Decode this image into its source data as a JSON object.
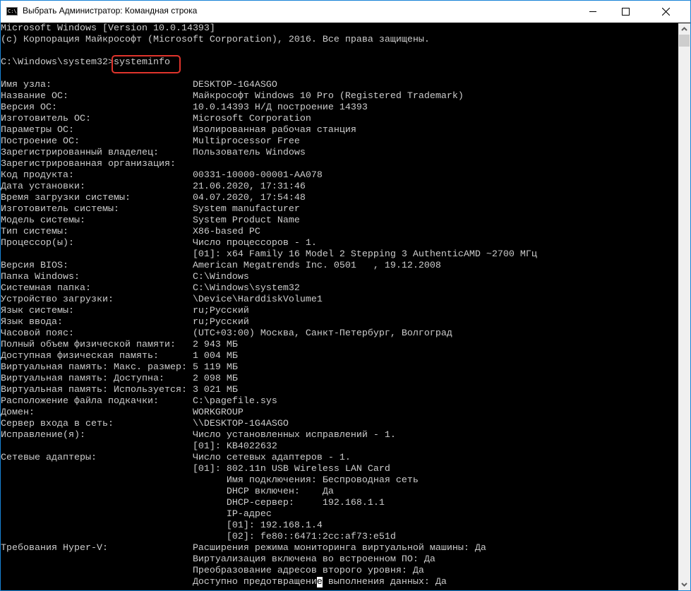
{
  "window": {
    "title": "Выбрать Администратор: Командная строка",
    "icon_text": "C:\\."
  },
  "console": {
    "header": [
      "Microsoft Windows [Version 10.0.14393]",
      "(c) Корпорация Майкрософт (Microsoft Corporation), 2016. Все права защищены."
    ],
    "prompt": "C:\\Windows\\system32>",
    "command": "systeminfo",
    "entries": [
      {
        "label": "Имя узла:",
        "value": "DESKTOP-1G4ASGO"
      },
      {
        "label": "Название ОС:",
        "value": "Майкрософт Windows 10 Pro (Registered Trademark)"
      },
      {
        "label": "Версия ОС:",
        "value": "10.0.14393 Н/Д построение 14393"
      },
      {
        "label": "Изготовитель ОС:",
        "value": "Microsoft Corporation"
      },
      {
        "label": "Параметры ОС:",
        "value": "Изолированная рабочая станция"
      },
      {
        "label": "Построение ОС:",
        "value": "Multiprocessor Free"
      },
      {
        "label": "Зарегистрированный владелец:",
        "value": "Пользователь Windows"
      },
      {
        "label": "Зарегистрированная организация:",
        "value": ""
      },
      {
        "label": "Код продукта:",
        "value": "00331-10000-00001-AA078"
      },
      {
        "label": "Дата установки:",
        "value": "21.06.2020, 17:31:46"
      },
      {
        "label": "Время загрузки системы:",
        "value": "04.07.2020, 17:54:48"
      },
      {
        "label": "Изготовитель системы:",
        "value": "System manufacturer"
      },
      {
        "label": "Модель системы:",
        "value": "System Product Name"
      },
      {
        "label": "Тип системы:",
        "value": "X86-based PC"
      },
      {
        "label": "Процессор(ы):",
        "value": "Число процессоров - 1."
      },
      {
        "label": "",
        "value": "[01]: x64 Family 16 Model 2 Stepping 3 AuthenticAMD ~2700 МГц"
      },
      {
        "label": "Версия BIOS:",
        "value": "American Megatrends Inc. 0501   , 19.12.2008"
      },
      {
        "label": "Папка Windows:",
        "value": "C:\\Windows"
      },
      {
        "label": "Системная папка:",
        "value": "C:\\Windows\\system32"
      },
      {
        "label": "Устройство загрузки:",
        "value": "\\Device\\HarddiskVolume1"
      },
      {
        "label": "Язык системы:",
        "value": "ru;Русский"
      },
      {
        "label": "Язык ввода:",
        "value": "ru;Русский"
      },
      {
        "label": "Часовой пояс:",
        "value": "(UTC+03:00) Москва, Санкт-Петербург, Волгоград"
      },
      {
        "label": "Полный объем физической памяти:",
        "value": "2 943 МБ"
      },
      {
        "label": "Доступная физическая память:",
        "value": "1 004 МБ"
      },
      {
        "label": "Виртуальная память: Макс. размер:",
        "value": "5 119 МБ"
      },
      {
        "label": "Виртуальная память: Доступна:",
        "value": "2 098 МБ"
      },
      {
        "label": "Виртуальная память: Используется:",
        "value": "3 021 МБ"
      },
      {
        "label": "Расположение файла подкачки:",
        "value": "C:\\pagefile.sys"
      },
      {
        "label": "Домен:",
        "value": "WORKGROUP"
      },
      {
        "label": "Сервер входа в сеть:",
        "value": "\\\\DESKTOP-1G4ASGO"
      },
      {
        "label": "Исправление(я):",
        "value": "Число установленных исправлений - 1."
      },
      {
        "label": "",
        "value": "[01]: KB4022632"
      },
      {
        "label": "Сетевые адаптеры:",
        "value": "Число сетевых адаптеров - 1."
      },
      {
        "label": "",
        "value": "[01]: 802.11n USB Wireless LAN Card"
      },
      {
        "label": "",
        "value": "      Имя подключения: Беспроводная сеть"
      },
      {
        "label": "",
        "value": "      DHCP включен:    Да"
      },
      {
        "label": "",
        "value": "      DHCP-сервер:     192.168.1.1"
      },
      {
        "label": "",
        "value": "      IP-адрес"
      },
      {
        "label": "",
        "value": "      [01]: 192.168.1.4"
      },
      {
        "label": "",
        "value": "      [02]: fe80::6471:2cc:af73:e51d"
      },
      {
        "label": "Требования Hyper-V:",
        "value": "Расширения режима мониторинга виртуальной машины: Да"
      },
      {
        "label": "",
        "value": "Виртуализация включена во встроенном ПО: Да"
      },
      {
        "label": "",
        "value": "Преобразование адресов второго уровня: Да"
      }
    ],
    "last_line": {
      "before": "Доступно предотвращени",
      "cursor": "е",
      "after": " выполнения данных: Да"
    }
  },
  "colors": {
    "text": "#cccccc",
    "background": "#000000",
    "highlight_box": "#e0342c",
    "border": "#1883d7"
  }
}
